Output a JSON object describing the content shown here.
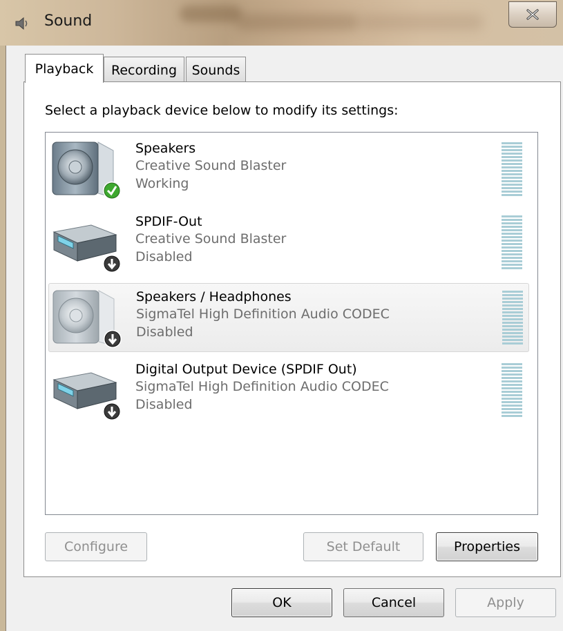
{
  "window": {
    "title": "Sound",
    "close_glyph": "✕"
  },
  "tabs": [
    {
      "label": "Playback",
      "active": true
    },
    {
      "label": "Recording",
      "active": false
    },
    {
      "label": "Sounds",
      "active": false
    }
  ],
  "playback": {
    "instruction": "Select a playback device below to modify its settings:",
    "devices": [
      {
        "name": "Speakers",
        "driver": "Creative Sound Blaster",
        "status": "Working",
        "icon": "speaker-icon",
        "badge": "default-check-icon",
        "selected": false
      },
      {
        "name": "SPDIF-Out",
        "driver": "Creative Sound Blaster",
        "status": "Disabled",
        "icon": "digital-receiver-icon",
        "badge": "disabled-arrow-icon",
        "selected": false
      },
      {
        "name": "Speakers / Headphones",
        "driver": "SigmaTel High Definition Audio CODEC",
        "status": "Disabled",
        "icon": "speaker-icon",
        "badge": "disabled-arrow-icon",
        "selected": true
      },
      {
        "name": "Digital Output Device (SPDIF Out)",
        "driver": "SigmaTel High Definition Audio CODEC",
        "status": "Disabled",
        "icon": "digital-receiver-icon",
        "badge": "disabled-arrow-icon",
        "selected": false
      }
    ],
    "configure_label": "Configure",
    "set_default_label": "Set Default",
    "properties_label": "Properties"
  },
  "footer": {
    "ok_label": "OK",
    "cancel_label": "Cancel",
    "apply_label": "Apply"
  },
  "colors": {
    "meter_bar": "#a9cdd6",
    "check_green": "#3ea82f",
    "selection": "#ececec"
  }
}
